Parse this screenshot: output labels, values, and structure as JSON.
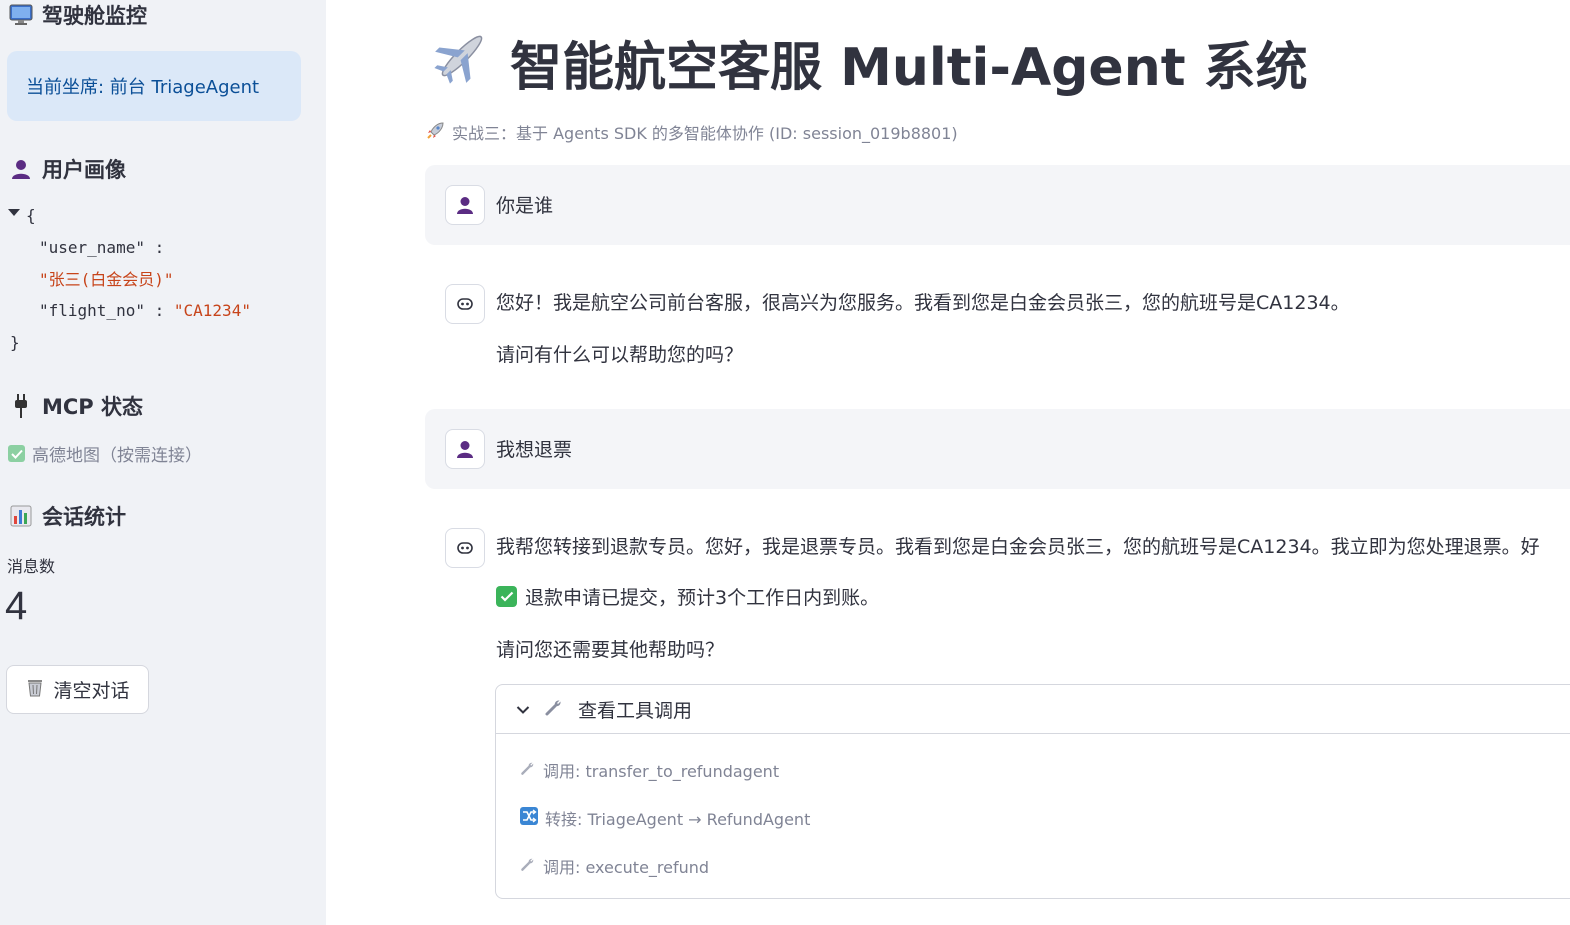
{
  "sidebar": {
    "cockpit_title": "驾驶舱监控",
    "current_seat": "当前坐席: 前台 TriageAgent",
    "profile_title": "用户画像",
    "profile_json": {
      "open_brace": "{",
      "close_brace": "}",
      "key_user_name": "\"user_name\"",
      "val_user_name": "\"张三(白金会员)\"",
      "key_flight_no": "\"flight_no\"",
      "val_flight_no": "\"CA1234\"",
      "colon": ":"
    },
    "mcp_title": "MCP 状态",
    "mcp_status": "高德地图（按需连接）",
    "stats_title": "会话统计",
    "metric_label": "消息数",
    "metric_value": "4",
    "clear_button": "清空对话"
  },
  "main": {
    "title": "智能航空客服 Multi-Agent 系统",
    "caption": "实战三：基于 Agents SDK 的多智能体协作 (ID: session_019b8801)",
    "messages": [
      {
        "role": "user",
        "lines": [
          "你是谁"
        ]
      },
      {
        "role": "assistant",
        "lines": [
          "您好！我是航空公司前台客服，很高兴为您服务。我看到您是白金会员张三，您的航班号是CA1234。",
          "请问有什么可以帮助您的吗？"
        ]
      },
      {
        "role": "user",
        "lines": [
          "我想退票"
        ]
      },
      {
        "role": "assistant",
        "lines": [
          "我帮您转接到退款专员。您好，我是退票专员。我看到您是白金会员张三，您的航班号是CA1234。我立即为您处理退票。好",
          "退款申请已提交，预计3个工作日内到账。",
          "请问您还需要其他帮助吗？"
        ]
      }
    ],
    "expander": {
      "label": "查看工具调用",
      "lines": [
        "调用: transfer_to_refundagent",
        "转接: TriageAgent → RefundAgent",
        "调用: execute_refund"
      ]
    }
  },
  "colors": {
    "sidebar_bg": "#f0f2f6",
    "seat_box_bg": "#dbe8f8",
    "seat_text": "#0b4f97",
    "json_string": "#c7441a",
    "user_avatar": "#5b2c83"
  },
  "icons": [
    "monitor-icon",
    "user-icon",
    "plug-icon",
    "check-icon",
    "bar-chart-icon",
    "wastebasket-icon",
    "airplane-icon",
    "rocket-icon",
    "assistant-icon",
    "chevron-down-icon",
    "wrench-icon",
    "shuffle-icon"
  ]
}
